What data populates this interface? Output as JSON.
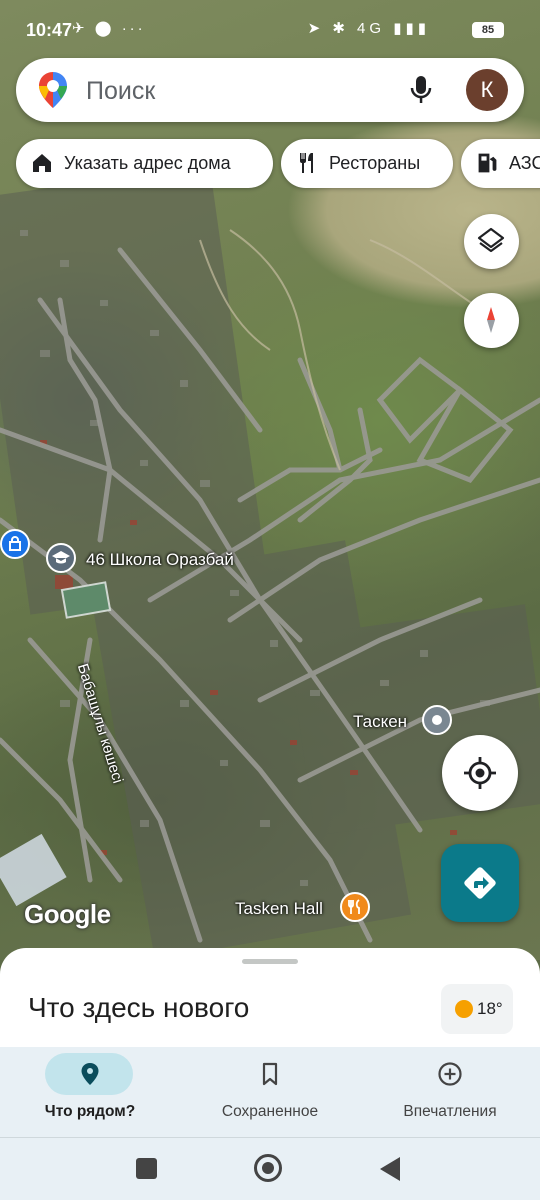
{
  "status_bar": {
    "time": "10:47",
    "left_icons": "✈ ⬤ ···",
    "right_icons": "➤ ✱ 4G ▮▮▮",
    "battery": "85"
  },
  "search": {
    "placeholder": "Поиск",
    "avatar_letter": "К"
  },
  "chips": [
    {
      "label": "Указать адрес дома",
      "icon": "home-icon"
    },
    {
      "label": "Рестораны",
      "icon": "restaurant-icon"
    },
    {
      "label": "АЗС",
      "icon": "gas-station-icon"
    }
  ],
  "map": {
    "labels": {
      "school": "46 Школа Оразбай",
      "street": "Бабашұлы көшесі",
      "place": "Таскен",
      "venue": "Tasken Hall"
    },
    "logo": "Google",
    "colors": {
      "school_poi": "#5b6b7a",
      "shop_poi": "#1a73e8",
      "place_poi": "#7a8791",
      "food_poi": "#f08a1c",
      "directions": "#0b7a8a"
    }
  },
  "sheet": {
    "title": "Что здесь нового",
    "weather_temp": "18°"
  },
  "bottom_nav": [
    {
      "label": "Что рядом?",
      "icon": "place-pin-icon",
      "active": true
    },
    {
      "label": "Сохраненное",
      "icon": "bookmark-icon",
      "active": false
    },
    {
      "label": "Впечатления",
      "icon": "add-circle-icon",
      "active": false
    }
  ]
}
